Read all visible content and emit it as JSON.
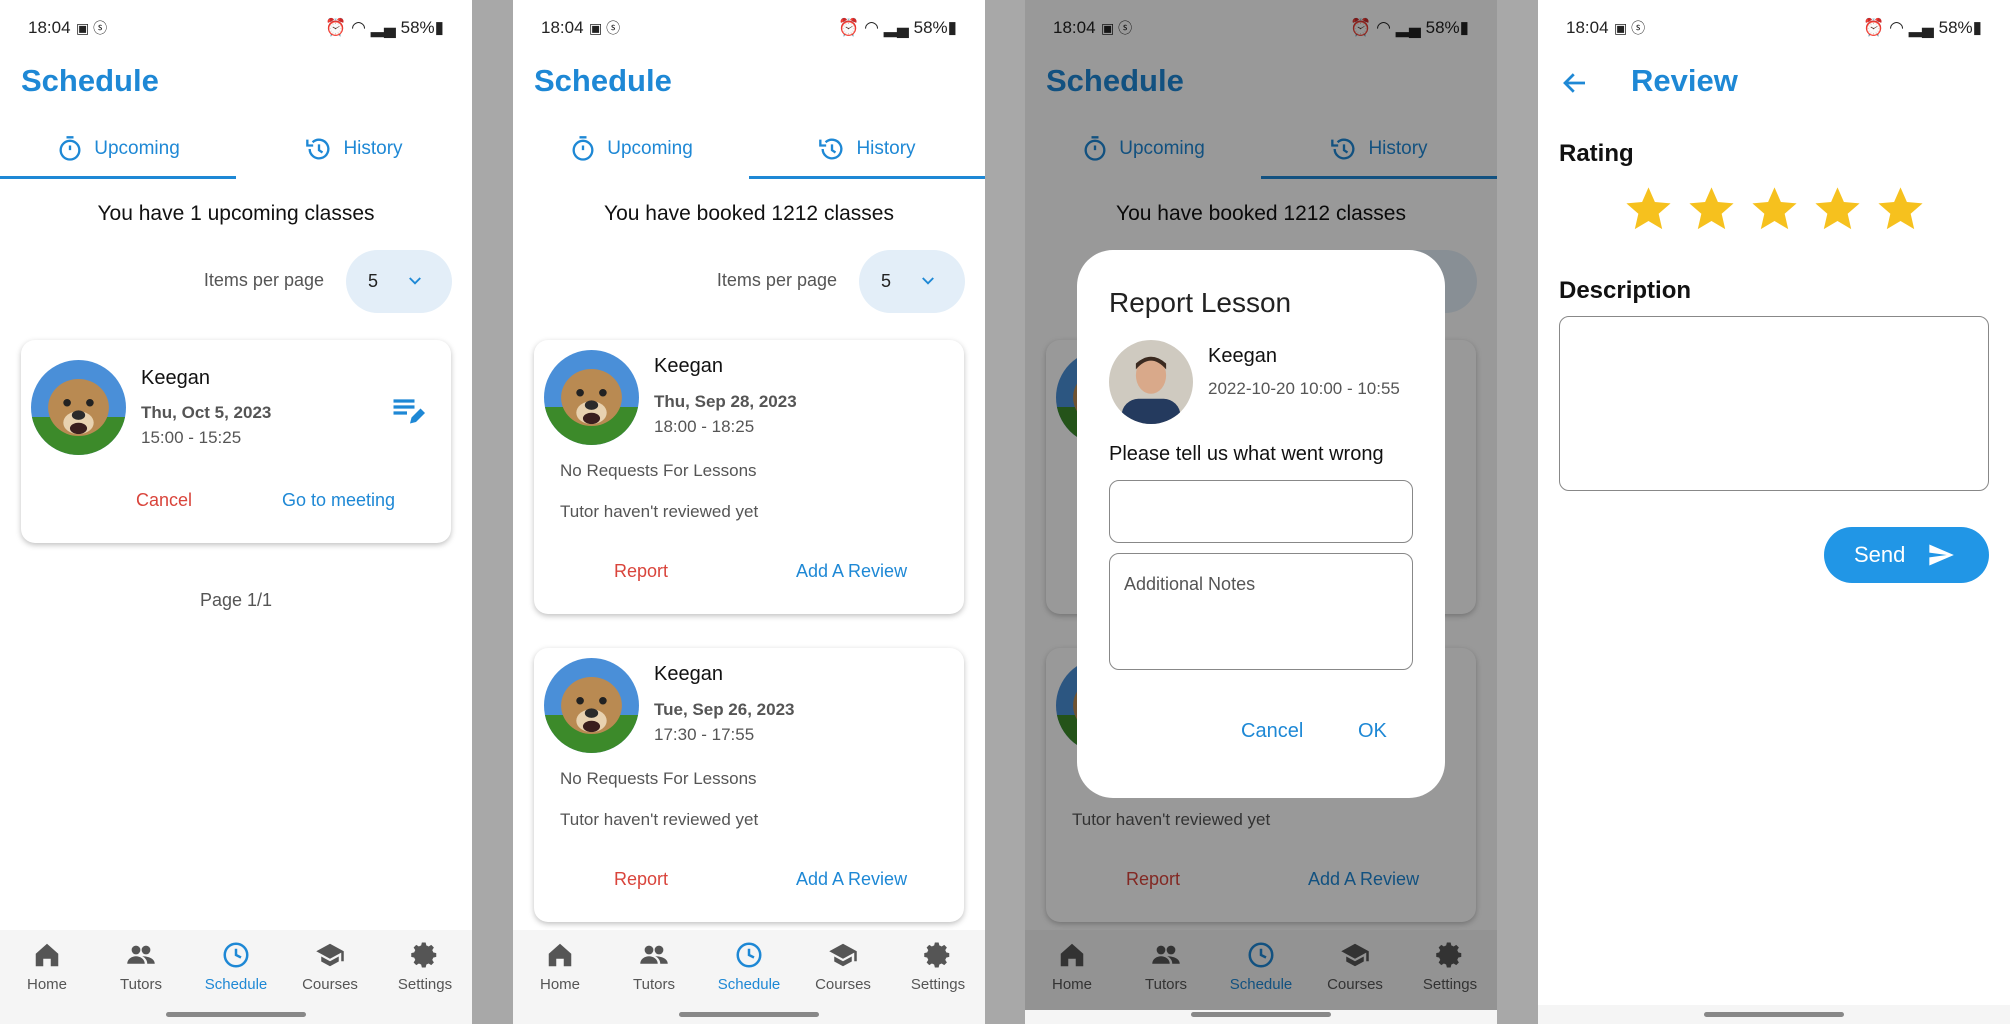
{
  "status_bar": {
    "time": "18:04",
    "battery": "58%"
  },
  "schedule": {
    "title": "Schedule",
    "tabs": [
      {
        "label": "Upcoming"
      },
      {
        "label": "History"
      }
    ],
    "items_per_page_label": "Items per page",
    "items_per_page_value": "5"
  },
  "upcoming": {
    "summary": "You have 1 upcoming classes",
    "card": {
      "name": "Keegan",
      "date": "Thu, Oct 5, 2023",
      "time": "15:00 - 15:25",
      "cancel": "Cancel",
      "meeting": "Go to meeting"
    },
    "page": "Page 1/1"
  },
  "history": {
    "summary": "You have booked 1212 classes",
    "cards": [
      {
        "name": "Keegan",
        "date": "Thu, Sep 28, 2023",
        "time": "18:00 - 18:25",
        "requests": "No Requests For Lessons",
        "review_status": "Tutor haven't reviewed yet",
        "report": "Report",
        "add_review": "Add A Review"
      },
      {
        "name": "Keegan",
        "date": "Tue, Sep 26, 2023",
        "time": "17:30 - 17:55",
        "requests": "No Requests For Lessons",
        "review_status": "Tutor haven't reviewed yet",
        "report": "Report",
        "add_review": "Add A Review"
      }
    ]
  },
  "report_dialog": {
    "title": "Report Lesson",
    "name": "Keegan",
    "meta": "2022-10-20    10:00 - 10:55",
    "question": "Please tell us what went wrong",
    "notes_placeholder": "Additional Notes",
    "cancel": "Cancel",
    "ok": "OK"
  },
  "review": {
    "title": "Review",
    "rating_label": "Rating",
    "rating": 5,
    "rating_max": 5,
    "description_label": "Description",
    "send": "Send"
  },
  "bottom_nav": {
    "items": [
      {
        "label": "Home",
        "icon": "home-icon"
      },
      {
        "label": "Tutors",
        "icon": "people-icon"
      },
      {
        "label": "Schedule",
        "icon": "clock-icon"
      },
      {
        "label": "Courses",
        "icon": "school-icon"
      },
      {
        "label": "Settings",
        "icon": "gear-icon"
      }
    ],
    "active": "Schedule"
  },
  "colors": {
    "accent": "#1e88d5",
    "danger": "#d9443b",
    "star": "#f6c11e"
  }
}
